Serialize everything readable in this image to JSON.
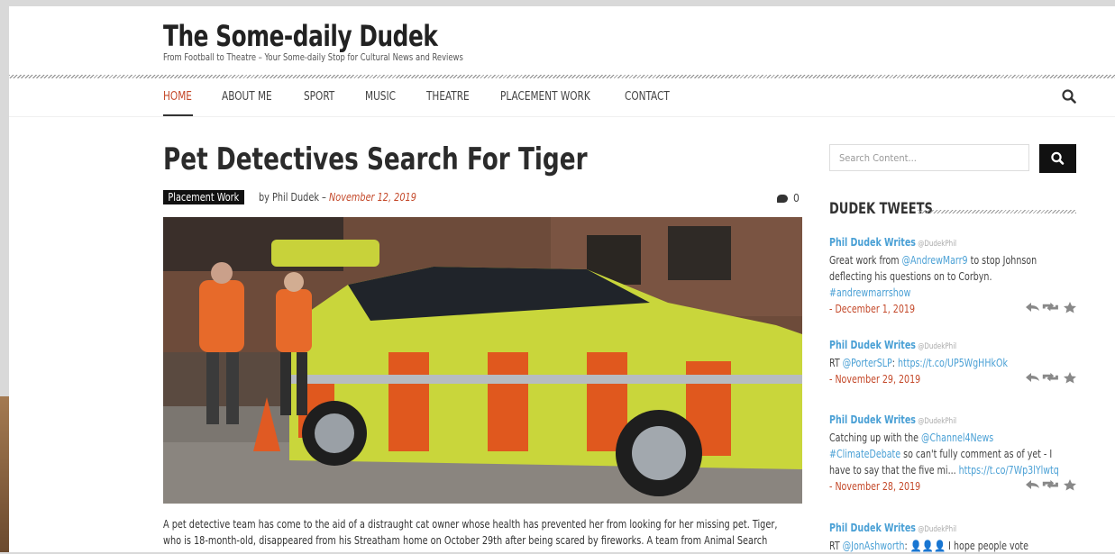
{
  "site": {
    "title": "The Some-daily Dudek",
    "tagline": "From Football to Theatre – Your Some-daily Stop for Cultural News and Reviews"
  },
  "nav": {
    "items": [
      "HOME",
      "ABOUT ME",
      "SPORT",
      "MUSIC",
      "THEATRE",
      "PLACEMENT WORK",
      "CONTACT"
    ],
    "active": "HOME"
  },
  "post": {
    "title": "Pet Detectives Search For Tiger",
    "category": "Placement Work",
    "by": "by",
    "author": "Phil Dudek",
    "separator": " – ",
    "date": "November 12, 2019",
    "comment_count": "0",
    "excerpt_lines": [
      "A pet detective team has come to the aid of a distraught cat owner whose health has prevented her from looking for her missing pet.  Tiger,",
      "who is 18-month-old, disappeared from his Streatham home on October 29th after being scared by fireworks.  A team from Animal Search"
    ]
  },
  "sidebar": {
    "search_placeholder": "Search Content...",
    "widget_title": "DUDEK TWEETS",
    "tweets": [
      {
        "name": "Phil Dudek Writes",
        "handle": "@DudekPhil",
        "lines": [
          [
            {
              "t": "Great work from "
            },
            {
              "t": "@AndrewMarr9",
              "link": true
            },
            {
              "t": " to stop Johnson"
            }
          ],
          [
            {
              "t": "deflecting his questions on to Corbyn."
            }
          ],
          [
            {
              "t": "#andrewmarrshow",
              "link": true
            }
          ]
        ],
        "date": "- December 1, 2019"
      },
      {
        "name": "Phil Dudek Writes",
        "handle": "@DudekPhil",
        "lines": [
          [
            {
              "t": "RT "
            },
            {
              "t": "@PorterSLP",
              "link": true
            },
            {
              "t": ": "
            },
            {
              "t": "https://t.co/UP5WgHHkOk",
              "link": true
            }
          ]
        ],
        "date": "- November 29, 2019"
      },
      {
        "name": "Phil Dudek Writes",
        "handle": "@DudekPhil",
        "lines": [
          [
            {
              "t": "Catching up with the "
            },
            {
              "t": "@Channel4News",
              "link": true
            }
          ],
          [
            {
              "t": "#ClimateDebate",
              "link": true
            },
            {
              "t": " so can't fully comment as of yet - I"
            }
          ],
          [
            {
              "t": "have to say that the five mi... "
            },
            {
              "t": "https://t.co/7Wp3lYlwtq",
              "link": true
            }
          ]
        ],
        "date": "- November 28, 2019"
      },
      {
        "name": "Phil Dudek Writes",
        "handle": "@DudekPhil",
        "lines": [
          [
            {
              "t": "RT "
            },
            {
              "t": "@JonAshworth",
              "link": true
            },
            {
              "t": ": 👤👤👤 I hope people vote"
            }
          ]
        ],
        "date": ""
      }
    ]
  },
  "colors": {
    "accent": "#c4492a",
    "twitter_blue": "#4aa0d5",
    "dark": "#111111"
  },
  "icons": {
    "nav_search": "search-icon",
    "sidebar_search": "search-icon",
    "comments": "comment-icon",
    "tweet_actions": [
      "reply-icon",
      "retweet-icon",
      "favorite-icon"
    ]
  }
}
